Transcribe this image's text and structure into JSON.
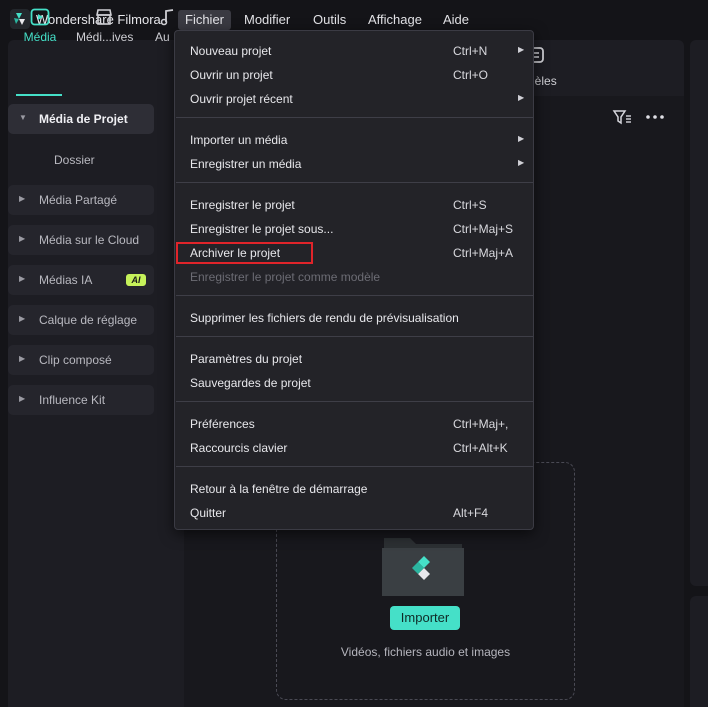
{
  "app": {
    "title": "Wondershare Filmora",
    "accent": "#45e0c8"
  },
  "menubar": [
    {
      "label": "Fichier",
      "active": true
    },
    {
      "label": "Modifier"
    },
    {
      "label": "Outils"
    },
    {
      "label": "Affichage"
    },
    {
      "label": "Aide"
    }
  ],
  "toolbar": {
    "media": "Média",
    "media_creatives": "Médi...ives",
    "audio": "Au",
    "templates": "dèles"
  },
  "sidebar": {
    "project_media": "Média de Projet",
    "folder": "Dossier",
    "shared_media": "Média Partagé",
    "cloud_media": "Média sur le Cloud",
    "ai_media": "Médias IA",
    "ai_badge": "AI",
    "adjustment_layer": "Calque de réglage",
    "compound_clip": "Clip composé",
    "influence_kit": "Influence Kit"
  },
  "main": {
    "import_button": "Importer",
    "drop_hint": "Vidéos, fichiers audio et images"
  },
  "file_menu": {
    "new_project": {
      "label": "Nouveau projet",
      "shortcut": "Ctrl+N",
      "has_submenu": true
    },
    "open_project": {
      "label": "Ouvrir un projet",
      "shortcut": "Ctrl+O"
    },
    "open_recent": {
      "label": "Ouvrir projet récent",
      "has_submenu": true
    },
    "import_media": {
      "label": "Importer un média",
      "has_submenu": true
    },
    "record_media": {
      "label": "Enregistrer un média",
      "has_submenu": true
    },
    "save_project": {
      "label": "Enregistrer le projet",
      "shortcut": "Ctrl+S"
    },
    "save_as": {
      "label": "Enregistrer le projet sous...",
      "shortcut": "Ctrl+Maj+S"
    },
    "archive_project": {
      "label": "Archiver le projet",
      "shortcut": "Ctrl+Maj+A",
      "highlighted": true
    },
    "save_as_template": {
      "label": "Enregistrer le projet comme modèle",
      "disabled": true
    },
    "delete_render_files": {
      "label": "Supprimer les fichiers de rendu de prévisualisation"
    },
    "project_settings": {
      "label": "Paramètres du projet"
    },
    "project_backups": {
      "label": "Sauvegardes de projet"
    },
    "preferences": {
      "label": "Préférences",
      "shortcut": "Ctrl+Maj+,"
    },
    "keyboard_shortcuts": {
      "label": "Raccourcis clavier",
      "shortcut": "Ctrl+Alt+K"
    },
    "back_to_startup": {
      "label": "Retour à la fenêtre de démarrage"
    },
    "quit": {
      "label": "Quitter",
      "shortcut": "Alt+F4"
    }
  },
  "highlight_color": "#e0242a"
}
